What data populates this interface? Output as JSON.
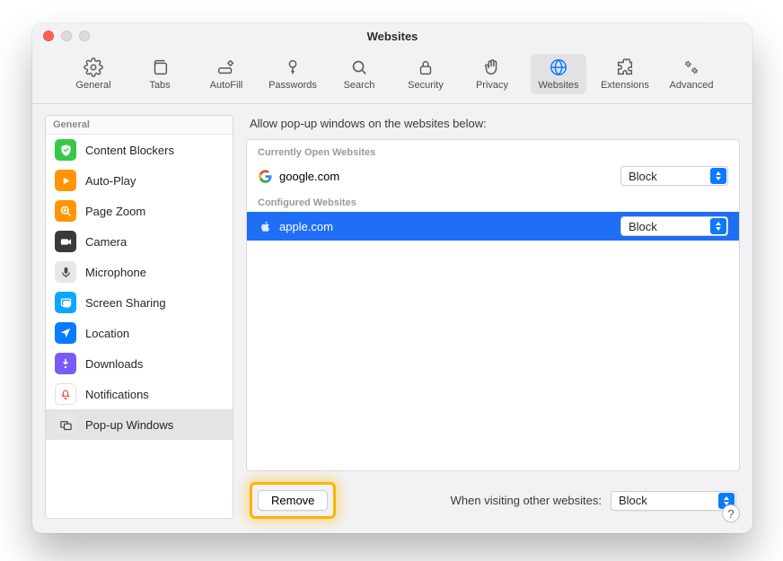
{
  "window": {
    "title": "Websites"
  },
  "toolbar": [
    {
      "id": "general",
      "label": "General"
    },
    {
      "id": "tabs",
      "label": "Tabs"
    },
    {
      "id": "autofill",
      "label": "AutoFill"
    },
    {
      "id": "passwords",
      "label": "Passwords"
    },
    {
      "id": "search",
      "label": "Search"
    },
    {
      "id": "security",
      "label": "Security"
    },
    {
      "id": "privacy",
      "label": "Privacy"
    },
    {
      "id": "websites",
      "label": "Websites",
      "active": true
    },
    {
      "id": "extensions",
      "label": "Extensions"
    },
    {
      "id": "advanced",
      "label": "Advanced"
    }
  ],
  "sidebar": {
    "header": "General",
    "items": [
      {
        "label": "Content Blockers"
      },
      {
        "label": "Auto-Play"
      },
      {
        "label": "Page Zoom"
      },
      {
        "label": "Camera"
      },
      {
        "label": "Microphone"
      },
      {
        "label": "Screen Sharing"
      },
      {
        "label": "Location"
      },
      {
        "label": "Downloads"
      },
      {
        "label": "Notifications"
      },
      {
        "label": "Pop-up Windows",
        "selected": true
      }
    ]
  },
  "main": {
    "title": "Allow pop-up windows on the websites below:",
    "sections": {
      "open_label": "Currently Open Websites",
      "configured_label": "Configured Websites"
    },
    "sites": {
      "open": [
        {
          "name": "google.com",
          "policy": "Block"
        }
      ],
      "configured": [
        {
          "name": "apple.com",
          "policy": "Block",
          "selected": true
        }
      ]
    },
    "remove_label": "Remove",
    "other_label": "When visiting other websites:",
    "other_policy": "Block"
  },
  "help_label": "?"
}
